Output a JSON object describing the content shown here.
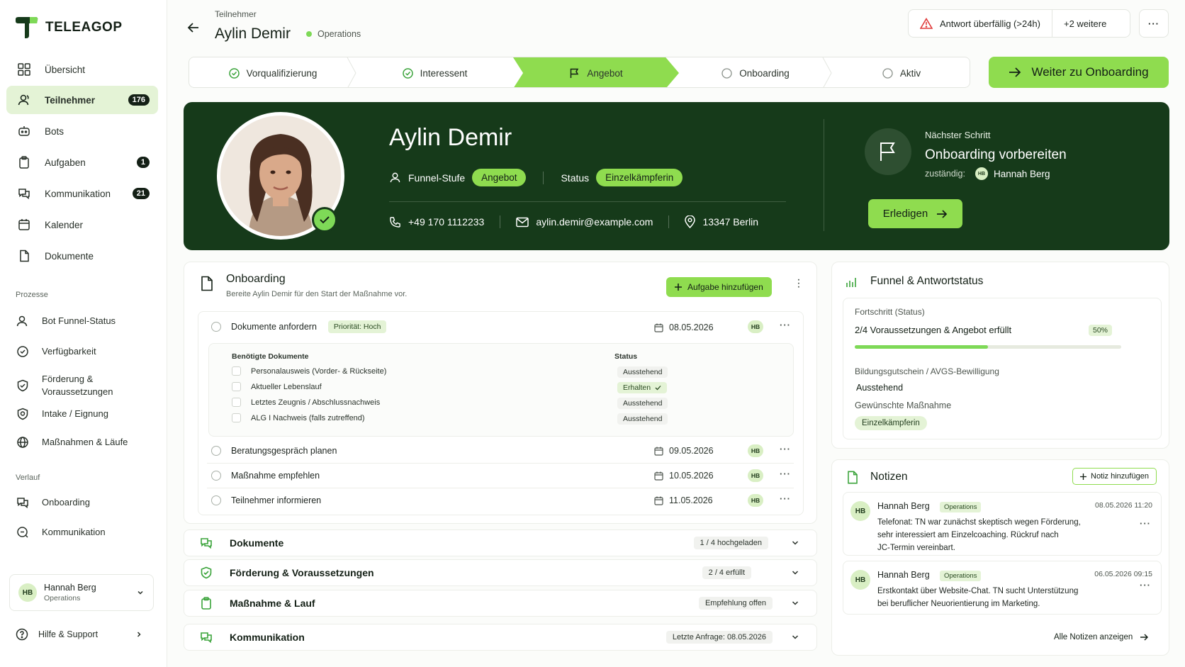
{
  "app": {
    "brand": "TELEAGOP"
  },
  "nav": {
    "items": [
      {
        "label": "Übersicht"
      },
      {
        "label": "Teilnehmer",
        "badge": "176"
      },
      {
        "label": "Bots"
      },
      {
        "label": "Aufgaben",
        "badge": "1"
      },
      {
        "label": "Kommunikation",
        "badge": "21"
      },
      {
        "label": "Kalender"
      },
      {
        "label": "Dokumente"
      }
    ],
    "section_prozesse": "Prozesse",
    "prozesse": [
      {
        "label": "Bot Funnel-Status"
      },
      {
        "label": "Verfügbarkeit"
      },
      {
        "label": "Förderung & Voraussetzungen"
      },
      {
        "label": "Intake / Eignung"
      },
      {
        "label": "Maßnahmen & Läufe"
      }
    ],
    "section_verlauf": "Verlauf",
    "verlauf": [
      {
        "label": "Onboarding"
      },
      {
        "label": "Kommunikation"
      }
    ],
    "user": {
      "initials": "HB",
      "name": "Hannah Berg",
      "role": "Operations"
    },
    "help": "Hilfe & Support"
  },
  "header": {
    "crumb": "Teilnehmer",
    "name": "Aylin Demir",
    "dept": "Operations",
    "alert": "Antwort überfällig (>24h)",
    "alert_more": "+2 weitere",
    "more": "···"
  },
  "stepper": {
    "steps": [
      {
        "label": "Vorqualifizierung",
        "state": "done"
      },
      {
        "label": "Interessent",
        "state": "done"
      },
      {
        "label": "Angebot",
        "state": "current"
      },
      {
        "label": "Onboarding",
        "state": "todo"
      },
      {
        "label": "Aktiv",
        "state": "todo"
      }
    ],
    "cta": "Weiter zu Onboarding"
  },
  "hero": {
    "name": "Aylin Demir",
    "funnel_label": "Funnel-Stufe",
    "funnel_value": "Angebot",
    "status_label": "Status",
    "status_value": "Einzelkämpferin",
    "phone": "+49 170 1112233",
    "email": "aylin.demir@example.com",
    "location": "13347 Berlin",
    "next_label": "Nächster Schritt",
    "next_title": "Onboarding vorbereiten",
    "owner_label": "zuständig:",
    "owner_initials": "HB",
    "owner_name": "Hannah Berg",
    "done": "Erledigen"
  },
  "onboarding": {
    "title": "Onboarding",
    "subtitle": "Bereite Aylin Demir für den Start der Maßnahme vor.",
    "add": "Aufgabe hinzufügen",
    "tasks": [
      {
        "title": "Dokumente anfordern",
        "priority": "Priorität: Hoch",
        "date": "08.05.2026",
        "owner": "HB"
      },
      {
        "title": "Beratungsgespräch planen",
        "date": "09.05.2026",
        "owner": "HB"
      },
      {
        "title": "Maßnahme empfehlen",
        "date": "10.05.2026",
        "owner": "HB"
      },
      {
        "title": "Teilnehmer informieren",
        "date": "11.05.2026",
        "owner": "HB"
      }
    ],
    "docs_header": "Benötigte Dokumente",
    "status_header": "Status",
    "docs": [
      {
        "name": "Personalausweis (Vorder- & Rückseite)",
        "status": "Ausstehend"
      },
      {
        "name": "Aktueller Lebenslauf",
        "status": "Erhalten"
      },
      {
        "name": "Letztes Zeugnis / Abschlussnachweis",
        "status": "Ausstehend"
      },
      {
        "name": "ALG I Nachweis (falls zutreffend)",
        "status": "Ausstehend"
      }
    ]
  },
  "accordions": [
    {
      "title": "Dokumente",
      "badge": "1 / 4 hochgeladen"
    },
    {
      "title": "Förderung & Voraussetzungen",
      "badge": "2 / 4 erfüllt"
    },
    {
      "title": "Maßnahme & Lauf",
      "badge": "Empfehlung offen"
    },
    {
      "title": "Kommunikation",
      "badge": "Letzte Anfrage: 08.05.2026"
    }
  ],
  "funnel": {
    "title": "Funnel & Antwortstatus",
    "progress_label": "Fortschritt (Status)",
    "progress_text": "2/4 Voraussetzungen & Angebot erfüllt",
    "progress_pct": "50%",
    "progress_value": 0.5,
    "voucher_label": "Bildungsgutschein / AVGS-Bewilligung",
    "voucher_value": "Ausstehend",
    "measure_label": "Gewünschte Maßnahme",
    "measure_value": "Einzelkämpferin"
  },
  "notes": {
    "title": "Notizen",
    "add": "Notiz hinzufügen",
    "all": "Alle Notizen anzeigen",
    "items": [
      {
        "initials": "HB",
        "author": "Hannah Berg",
        "team": "Operations",
        "time": "08.05.2026 11:20",
        "l1": "Telefonat: TN war zunächst skeptisch wegen Förderung,",
        "l2": "sehr interessiert am Einzelcoaching. Rückruf nach",
        "l3": "JC-Termin vereinbart."
      },
      {
        "initials": "HB",
        "author": "Hannah Berg",
        "team": "Operations",
        "time": "06.05.2026 09:15",
        "l1": "Erstkontakt über Website-Chat. TN sucht Unterstützung",
        "l2": "bei beruflicher Neuorientierung im Marketing."
      }
    ]
  },
  "colors": {
    "accent": "#8fdc4f",
    "dark": "#163a1a",
    "soft": "#e4f3d6"
  }
}
